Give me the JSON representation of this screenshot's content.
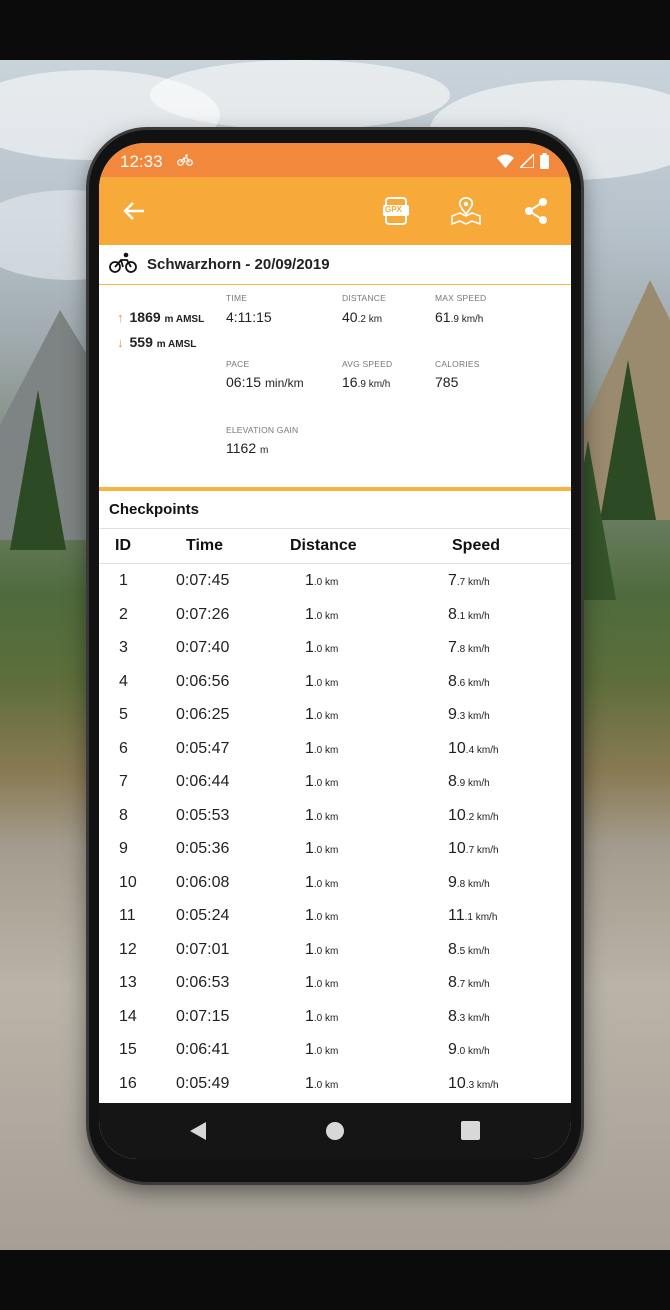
{
  "status_bar": {
    "time": "12:33"
  },
  "trip": {
    "title": "Schwarzhorn - 20/09/2019"
  },
  "altitude": {
    "max": {
      "value": "1869",
      "unit": "m AMSL"
    },
    "min": {
      "value": "559",
      "unit": "m AMSL"
    }
  },
  "stats": {
    "time": {
      "label": "TIME",
      "value": "4:11:15"
    },
    "distance": {
      "label": "DISTANCE",
      "int": "40",
      "dec": ".2 km"
    },
    "max_speed": {
      "label": "MAX SPEED",
      "int": "61",
      "dec": ".9 km/h"
    },
    "pace": {
      "label": "PACE",
      "value": "06:15",
      "unit": "min/km"
    },
    "avg_speed": {
      "label": "AVG SPEED",
      "int": "16",
      "dec": ".9 km/h"
    },
    "calories": {
      "label": "CALORIES",
      "value": "785"
    },
    "elevation_gain": {
      "label": "ELEVATION GAIN",
      "value": "1162",
      "unit": "m"
    }
  },
  "checkpoints": {
    "title": "Checkpoints",
    "columns": [
      "ID",
      "Time",
      "Distance",
      "Speed"
    ],
    "rows": [
      {
        "id": "1",
        "time": "0:07:45",
        "dist_int": "1",
        "dist_dec": ".0 km",
        "speed_int": "7",
        "speed_dec": ".7 km/h"
      },
      {
        "id": "2",
        "time": "0:07:26",
        "dist_int": "1",
        "dist_dec": ".0 km",
        "speed_int": "8",
        "speed_dec": ".1 km/h"
      },
      {
        "id": "3",
        "time": "0:07:40",
        "dist_int": "1",
        "dist_dec": ".0 km",
        "speed_int": "7",
        "speed_dec": ".8 km/h"
      },
      {
        "id": "4",
        "time": "0:06:56",
        "dist_int": "1",
        "dist_dec": ".0 km",
        "speed_int": "8",
        "speed_dec": ".6 km/h"
      },
      {
        "id": "5",
        "time": "0:06:25",
        "dist_int": "1",
        "dist_dec": ".0 km",
        "speed_int": "9",
        "speed_dec": ".3 km/h"
      },
      {
        "id": "6",
        "time": "0:05:47",
        "dist_int": "1",
        "dist_dec": ".0 km",
        "speed_int": "10",
        "speed_dec": ".4 km/h"
      },
      {
        "id": "7",
        "time": "0:06:44",
        "dist_int": "1",
        "dist_dec": ".0 km",
        "speed_int": "8",
        "speed_dec": ".9 km/h"
      },
      {
        "id": "8",
        "time": "0:05:53",
        "dist_int": "1",
        "dist_dec": ".0 km",
        "speed_int": "10",
        "speed_dec": ".2 km/h"
      },
      {
        "id": "9",
        "time": "0:05:36",
        "dist_int": "1",
        "dist_dec": ".0 km",
        "speed_int": "10",
        "speed_dec": ".7 km/h"
      },
      {
        "id": "10",
        "time": "0:06:08",
        "dist_int": "1",
        "dist_dec": ".0 km",
        "speed_int": "9",
        "speed_dec": ".8 km/h"
      },
      {
        "id": "11",
        "time": "0:05:24",
        "dist_int": "1",
        "dist_dec": ".0 km",
        "speed_int": "11",
        "speed_dec": ".1 km/h"
      },
      {
        "id": "12",
        "time": "0:07:01",
        "dist_int": "1",
        "dist_dec": ".0 km",
        "speed_int": "8",
        "speed_dec": ".5 km/h"
      },
      {
        "id": "13",
        "time": "0:06:53",
        "dist_int": "1",
        "dist_dec": ".0 km",
        "speed_int": "8",
        "speed_dec": ".7 km/h"
      },
      {
        "id": "14",
        "time": "0:07:15",
        "dist_int": "1",
        "dist_dec": ".0 km",
        "speed_int": "8",
        "speed_dec": ".3 km/h"
      },
      {
        "id": "15",
        "time": "0:06:41",
        "dist_int": "1",
        "dist_dec": ".0 km",
        "speed_int": "9",
        "speed_dec": ".0 km/h"
      },
      {
        "id": "16",
        "time": "0:05:49",
        "dist_int": "1",
        "dist_dec": ".0 km",
        "speed_int": "10",
        "speed_dec": ".3 km/h"
      }
    ]
  },
  "toolbar": {
    "gpx_label": "GPX"
  },
  "colors": {
    "appbar": "#f7a93a",
    "statusbar": "#f2883c",
    "accent": "#f2883c"
  },
  "icons": [
    "back-arrow-icon",
    "gpx-file-icon",
    "map-pin-icon",
    "share-icon",
    "bicycle-icon",
    "wifi-icon",
    "cell-signal-icon",
    "battery-icon"
  ]
}
